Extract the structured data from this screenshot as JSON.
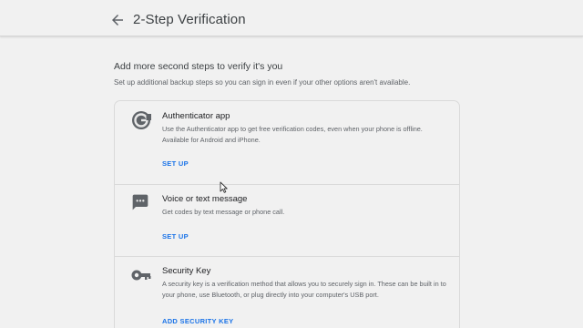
{
  "header": {
    "title": "2-Step Verification",
    "back_icon": "arrow-back-icon"
  },
  "section": {
    "heading": "Add more second steps to verify it's you",
    "subheading": "Set up additional backup steps so you can sign in even if your other options aren't available."
  },
  "options": [
    {
      "icon": "authenticator-app-icon",
      "title": "Authenticator app",
      "description": "Use the Authenticator app to get free verification codes, even when your phone is offline. Available for Android and iPhone.",
      "action": "SET UP"
    },
    {
      "icon": "message-icon",
      "title": "Voice or text message",
      "description": "Get codes by text message or phone call.",
      "action": "SET UP"
    },
    {
      "icon": "key-icon",
      "title": "Security Key",
      "description": "A security key is a verification method that allows you to securely sign in. These can be built in to your phone, use Bluetooth, or plug directly into your computer's USB port.",
      "action": "ADD SECURITY KEY"
    }
  ],
  "colors": {
    "background": "#f1f1f1",
    "accent": "#1a73e8",
    "text_primary": "#202124",
    "text_secondary": "#5f6368"
  }
}
